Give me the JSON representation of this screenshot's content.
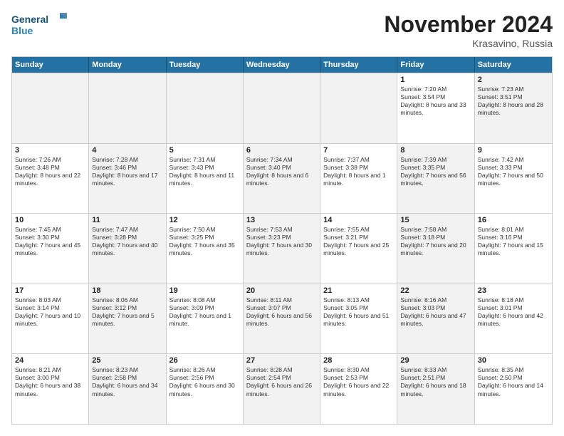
{
  "header": {
    "logo_line1": "General",
    "logo_line2": "Blue",
    "month": "November 2024",
    "location": "Krasavino, Russia"
  },
  "weekdays": [
    "Sunday",
    "Monday",
    "Tuesday",
    "Wednesday",
    "Thursday",
    "Friday",
    "Saturday"
  ],
  "rows": [
    [
      {
        "day": "",
        "text": "",
        "shaded": true
      },
      {
        "day": "",
        "text": "",
        "shaded": true
      },
      {
        "day": "",
        "text": "",
        "shaded": true
      },
      {
        "day": "",
        "text": "",
        "shaded": true
      },
      {
        "day": "",
        "text": "",
        "shaded": true
      },
      {
        "day": "1",
        "text": "Sunrise: 7:20 AM\nSunset: 3:54 PM\nDaylight: 8 hours and 33 minutes.",
        "shaded": false
      },
      {
        "day": "2",
        "text": "Sunrise: 7:23 AM\nSunset: 3:51 PM\nDaylight: 8 hours and 28 minutes.",
        "shaded": true
      }
    ],
    [
      {
        "day": "3",
        "text": "Sunrise: 7:26 AM\nSunset: 3:48 PM\nDaylight: 8 hours and 22 minutes.",
        "shaded": false
      },
      {
        "day": "4",
        "text": "Sunrise: 7:28 AM\nSunset: 3:46 PM\nDaylight: 8 hours and 17 minutes.",
        "shaded": true
      },
      {
        "day": "5",
        "text": "Sunrise: 7:31 AM\nSunset: 3:43 PM\nDaylight: 8 hours and 11 minutes.",
        "shaded": false
      },
      {
        "day": "6",
        "text": "Sunrise: 7:34 AM\nSunset: 3:40 PM\nDaylight: 8 hours and 6 minutes.",
        "shaded": true
      },
      {
        "day": "7",
        "text": "Sunrise: 7:37 AM\nSunset: 3:38 PM\nDaylight: 8 hours and 1 minute.",
        "shaded": false
      },
      {
        "day": "8",
        "text": "Sunrise: 7:39 AM\nSunset: 3:35 PM\nDaylight: 7 hours and 56 minutes.",
        "shaded": true
      },
      {
        "day": "9",
        "text": "Sunrise: 7:42 AM\nSunset: 3:33 PM\nDaylight: 7 hours and 50 minutes.",
        "shaded": false
      }
    ],
    [
      {
        "day": "10",
        "text": "Sunrise: 7:45 AM\nSunset: 3:30 PM\nDaylight: 7 hours and 45 minutes.",
        "shaded": false
      },
      {
        "day": "11",
        "text": "Sunrise: 7:47 AM\nSunset: 3:28 PM\nDaylight: 7 hours and 40 minutes.",
        "shaded": true
      },
      {
        "day": "12",
        "text": "Sunrise: 7:50 AM\nSunset: 3:25 PM\nDaylight: 7 hours and 35 minutes.",
        "shaded": false
      },
      {
        "day": "13",
        "text": "Sunrise: 7:53 AM\nSunset: 3:23 PM\nDaylight: 7 hours and 30 minutes.",
        "shaded": true
      },
      {
        "day": "14",
        "text": "Sunrise: 7:55 AM\nSunset: 3:21 PM\nDaylight: 7 hours and 25 minutes.",
        "shaded": false
      },
      {
        "day": "15",
        "text": "Sunrise: 7:58 AM\nSunset: 3:18 PM\nDaylight: 7 hours and 20 minutes.",
        "shaded": true
      },
      {
        "day": "16",
        "text": "Sunrise: 8:01 AM\nSunset: 3:16 PM\nDaylight: 7 hours and 15 minutes.",
        "shaded": false
      }
    ],
    [
      {
        "day": "17",
        "text": "Sunrise: 8:03 AM\nSunset: 3:14 PM\nDaylight: 7 hours and 10 minutes.",
        "shaded": false
      },
      {
        "day": "18",
        "text": "Sunrise: 8:06 AM\nSunset: 3:12 PM\nDaylight: 7 hours and 5 minutes.",
        "shaded": true
      },
      {
        "day": "19",
        "text": "Sunrise: 8:08 AM\nSunset: 3:09 PM\nDaylight: 7 hours and 1 minute.",
        "shaded": false
      },
      {
        "day": "20",
        "text": "Sunrise: 8:11 AM\nSunset: 3:07 PM\nDaylight: 6 hours and 56 minutes.",
        "shaded": true
      },
      {
        "day": "21",
        "text": "Sunrise: 8:13 AM\nSunset: 3:05 PM\nDaylight: 6 hours and 51 minutes.",
        "shaded": false
      },
      {
        "day": "22",
        "text": "Sunrise: 8:16 AM\nSunset: 3:03 PM\nDaylight: 6 hours and 47 minutes.",
        "shaded": true
      },
      {
        "day": "23",
        "text": "Sunrise: 8:18 AM\nSunset: 3:01 PM\nDaylight: 6 hours and 42 minutes.",
        "shaded": false
      }
    ],
    [
      {
        "day": "24",
        "text": "Sunrise: 8:21 AM\nSunset: 3:00 PM\nDaylight: 6 hours and 38 minutes.",
        "shaded": false
      },
      {
        "day": "25",
        "text": "Sunrise: 8:23 AM\nSunset: 2:58 PM\nDaylight: 6 hours and 34 minutes.",
        "shaded": true
      },
      {
        "day": "26",
        "text": "Sunrise: 8:26 AM\nSunset: 2:56 PM\nDaylight: 6 hours and 30 minutes.",
        "shaded": false
      },
      {
        "day": "27",
        "text": "Sunrise: 8:28 AM\nSunset: 2:54 PM\nDaylight: 6 hours and 26 minutes.",
        "shaded": true
      },
      {
        "day": "28",
        "text": "Sunrise: 8:30 AM\nSunset: 2:53 PM\nDaylight: 6 hours and 22 minutes.",
        "shaded": false
      },
      {
        "day": "29",
        "text": "Sunrise: 8:33 AM\nSunset: 2:51 PM\nDaylight: 6 hours and 18 minutes.",
        "shaded": true
      },
      {
        "day": "30",
        "text": "Sunrise: 8:35 AM\nSunset: 2:50 PM\nDaylight: 6 hours and 14 minutes.",
        "shaded": false
      }
    ]
  ]
}
